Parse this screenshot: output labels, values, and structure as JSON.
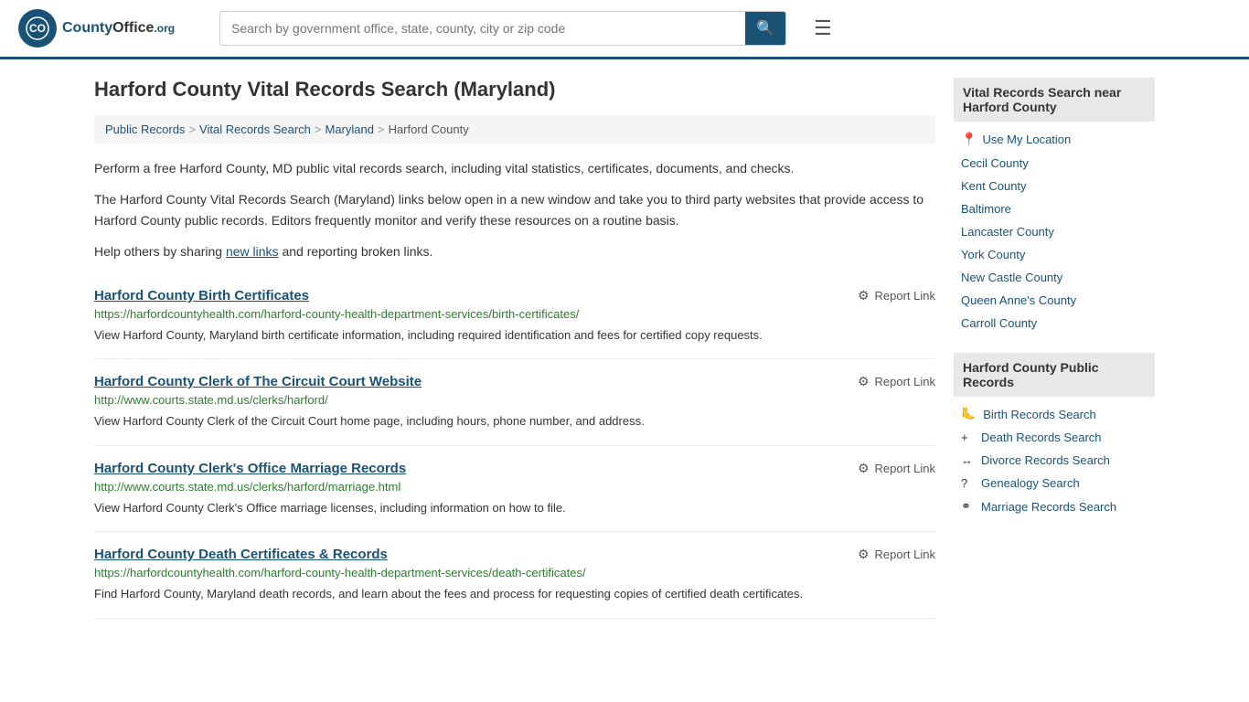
{
  "header": {
    "logo_text": "County",
    "logo_org": "Office",
    "logo_tld": ".org",
    "search_placeholder": "Search by government office, state, county, city or zip code"
  },
  "page": {
    "title": "Harford County Vital Records Search (Maryland)"
  },
  "breadcrumb": {
    "items": [
      "Public Records",
      "Vital Records Search",
      "Maryland",
      "Harford County"
    ]
  },
  "description": {
    "para1": "Perform a free Harford County, MD public vital records search, including vital statistics, certificates, documents, and checks.",
    "para2": "The Harford County Vital Records Search (Maryland) links below open in a new window and take you to third party websites that provide access to Harford County public records. Editors frequently monitor and verify these resources on a routine basis.",
    "para3_pre": "Help others by sharing ",
    "para3_link": "new links",
    "para3_post": " and reporting broken links."
  },
  "results": [
    {
      "title": "Harford County Birth Certificates",
      "url": "https://harfordcountyhealth.com/harford-county-health-department-services/birth-certificates/",
      "description": "View Harford County, Maryland birth certificate information, including required identification and fees for certified copy requests."
    },
    {
      "title": "Harford County Clerk of The Circuit Court Website",
      "url": "http://www.courts.state.md.us/clerks/harford/",
      "description": "View Harford County Clerk of the Circuit Court home page, including hours, phone number, and address."
    },
    {
      "title": "Harford County Clerk's Office Marriage Records",
      "url": "http://www.courts.state.md.us/clerks/harford/marriage.html",
      "description": "View Harford County Clerk's Office marriage licenses, including information on how to file."
    },
    {
      "title": "Harford County Death Certificates & Records",
      "url": "https://harfordcountyhealth.com/harford-county-health-department-services/death-certificates/",
      "description": "Find Harford County, Maryland death records, and learn about the fees and process for requesting copies of certified death certificates."
    }
  ],
  "report_link_label": "Report Link",
  "sidebar": {
    "nearby_header": "Vital Records Search near Harford County",
    "location_label": "Use My Location",
    "nearby_counties": [
      "Cecil County",
      "Kent County",
      "Baltimore",
      "Lancaster County",
      "York County",
      "New Castle County",
      "Queen Anne's County",
      "Carroll County"
    ],
    "public_records_header": "Harford County Public Records",
    "public_records_links": [
      {
        "icon": "🦶",
        "label": "Birth Records Search"
      },
      {
        "icon": "+",
        "label": "Death Records Search"
      },
      {
        "icon": "↔",
        "label": "Divorce Records Search"
      },
      {
        "icon": "?",
        "label": "Genealogy Search"
      },
      {
        "icon": "⚭",
        "label": "Marriage Records Search"
      }
    ]
  }
}
